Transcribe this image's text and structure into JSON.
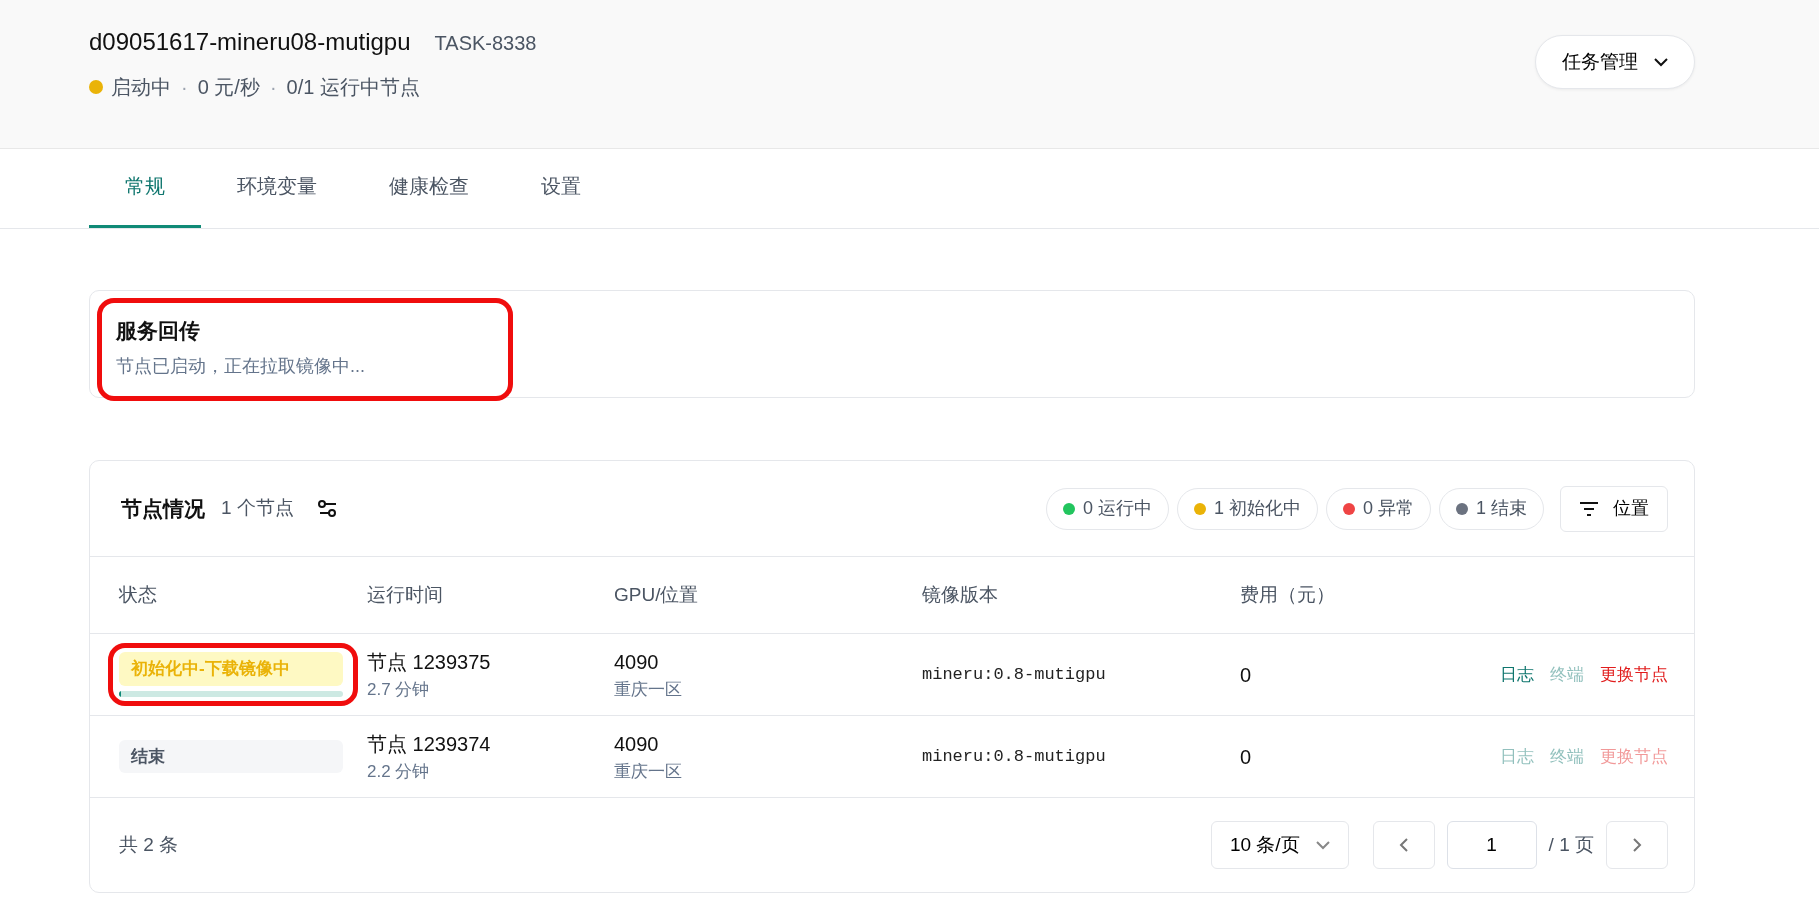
{
  "header": {
    "title": "d09051617-mineru08-mutigpu",
    "task_id": "TASK-8338",
    "status": {
      "label": "启动中",
      "color": "#eab308"
    },
    "separator": "·",
    "rate": "0 元/秒",
    "separator_2": "·",
    "nodes_running": "0/1 运行中节点",
    "menu_button": "任务管理"
  },
  "tabs": [
    {
      "label": "常规",
      "selected": true
    },
    {
      "label": "环境变量",
      "selected": false
    },
    {
      "label": "健康检查",
      "selected": false
    },
    {
      "label": "设置",
      "selected": false
    }
  ],
  "service_callback": {
    "title": "服务回传",
    "message": "节点已启动，正在拉取镜像中...",
    "highlighted": true
  },
  "nodes": {
    "title": "节点情况",
    "count": "1 个节点",
    "status_chips": [
      {
        "label": "0 运行中",
        "color": "#22c55e"
      },
      {
        "label": "1 初始化中",
        "color": "#eab308"
      },
      {
        "label": "0 异常",
        "color": "#ef4444"
      },
      {
        "label": "1 结束",
        "color": "#6b7280"
      }
    ],
    "location_button": "位置",
    "table": {
      "columns": [
        "状态",
        "运行时间",
        "GPU/位置",
        "镜像版本",
        "费用（元）"
      ],
      "rows": [
        {
          "status": {
            "kind": "initializing",
            "label": "初始化中-下载镜像中",
            "level": 0.01
          },
          "highlighted": true,
          "node": "节点 1239375",
          "runtime": "2.7 分钟",
          "gpu": "4090",
          "location": "重庆一区",
          "image": "mineru:0.8-mutigpu",
          "cost": "0",
          "actions": [
            {
              "kind": "log",
              "label": "日志",
              "disabled": false
            },
            {
              "kind": "terminal",
              "label": "终端",
              "disabled": true
            },
            {
              "kind": "replace",
              "label": "更换节点",
              "disabled": false
            }
          ]
        },
        {
          "status": {
            "kind": "ended",
            "label": "结束"
          },
          "highlighted": false,
          "node": "节点 1239374",
          "runtime": "2.2 分钟",
          "gpu": "4090",
          "location": "重庆一区",
          "image": "mineru:0.8-mutigpu",
          "cost": "0",
          "actions": [
            {
              "kind": "log",
              "label": "日志",
              "disabled": true
            },
            {
              "kind": "terminal",
              "label": "终端",
              "disabled": true
            },
            {
              "kind": "replace",
              "label": "更换节点",
              "disabled": true
            }
          ]
        }
      ]
    },
    "pagination": {
      "total": "共 2 条",
      "page_size": "10 条/页",
      "page": "1",
      "page_total": "/ 1 页"
    }
  }
}
